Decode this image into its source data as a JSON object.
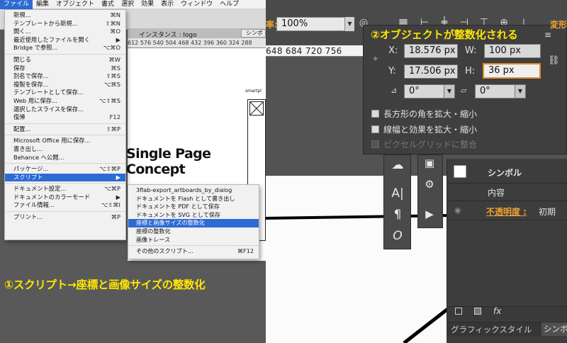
{
  "menubar": {
    "items": [
      "ファイル",
      "編集",
      "オブジェクト",
      "書式",
      "選択",
      "効果",
      "表示",
      "ウィンドウ",
      "ヘルプ"
    ]
  },
  "control": {
    "instance_label": "インスタンス : logo",
    "symbol_button": "シンボ",
    "ruler_ticks": "612  576  540  504  468  432  396  360  324  288"
  },
  "file_menu": {
    "groups": [
      [
        {
          "label": "新規...",
          "shortcut": "⌘N"
        },
        {
          "label": "テンプレートから新規...",
          "shortcut": "⇧⌘N"
        },
        {
          "label": "開く...",
          "shortcut": "⌘O"
        },
        {
          "label": "最近使用したファイルを開く",
          "shortcut": "▶"
        },
        {
          "label": "Bridge で参照...",
          "shortcut": "⌥⌘O"
        }
      ],
      [
        {
          "label": "閉じる",
          "shortcut": "⌘W"
        },
        {
          "label": "保存",
          "shortcut": "⌘S"
        },
        {
          "label": "別名で保存...",
          "shortcut": "⇧⌘S"
        },
        {
          "label": "複製を保存...",
          "shortcut": "⌥⌘S"
        },
        {
          "label": "テンプレートとして保存...",
          "shortcut": ""
        },
        {
          "label": "Web 用に保存...",
          "shortcut": "⌥⇧⌘S"
        },
        {
          "label": "選択したスライスを保存...",
          "shortcut": ""
        },
        {
          "label": "復帰",
          "shortcut": "F12"
        }
      ],
      [
        {
          "label": "配置...",
          "shortcut": "⇧⌘P"
        }
      ],
      [
        {
          "label": "Microsoft Office 用に保存...",
          "shortcut": ""
        },
        {
          "label": "書き出し...",
          "shortcut": ""
        },
        {
          "label": "Behance へ公開...",
          "shortcut": ""
        }
      ],
      [
        {
          "label": "パッケージ...",
          "shortcut": "⌥⇧⌘P"
        },
        {
          "label": "スクリプト",
          "shortcut": "▶",
          "selected": true
        }
      ],
      [
        {
          "label": "ドキュメント設定...",
          "shortcut": "⌥⌘P"
        },
        {
          "label": "ドキュメントのカラーモード",
          "shortcut": "▶"
        },
        {
          "label": "ファイル情報...",
          "shortcut": "⌥⇧⌘I"
        }
      ],
      [
        {
          "label": "プリント...",
          "shortcut": "⌘P"
        }
      ]
    ]
  },
  "script_submenu": {
    "items": [
      {
        "label": "3flab-export_artboards_by_dialog",
        "shortcut": ""
      },
      {
        "label": "ドキュメントを Flash として書き出し",
        "shortcut": ""
      },
      {
        "label": "ドキュメントを PDF として保存",
        "shortcut": ""
      },
      {
        "label": "ドキュメントを SVG として保存",
        "shortcut": ""
      },
      {
        "label": "座標と画像サイズの整数化",
        "shortcut": "",
        "selected": true
      },
      {
        "label": "座標の整数化",
        "shortcut": ""
      },
      {
        "label": "画像トレース",
        "shortcut": ""
      }
    ],
    "other": {
      "label": "その他のスクリプト...",
      "shortcut": "⌘F12"
    }
  },
  "artboard": {
    "small_label": "smartpl",
    "title_line1": "Single Page",
    "title_line2": "Concept"
  },
  "annotations": {
    "step1": "①スクリプト→座標と画像サイズの整数化",
    "step2": "②オブジェクトが整数化される"
  },
  "right": {
    "zoom_label": "率:",
    "zoom_value": "100%",
    "ruler_ticks": "648   684   720   756",
    "panel_tab": "変形"
  },
  "transform": {
    "x_label": "X:",
    "x_value": "18.576 px",
    "y_label": "Y:",
    "y_value": "17.506 px",
    "w_label": "W:",
    "w_value": "100 px",
    "h_label": "H:",
    "h_value": "36 px",
    "rotate_value": "0°",
    "shear_value": "0°",
    "check1": "長方形の角を拡大・縮小",
    "check2": "線幅と効果を拡大・縮小",
    "check3": "ピクセルグリッドに整合"
  },
  "appearance": {
    "symbol": "シンボル",
    "content": "内容",
    "opacity_label": "不透明度 :",
    "opacity_value": "初期",
    "fx_label": "fx",
    "tab1": "グラフィックスタイル",
    "tab2": "シンボ"
  }
}
